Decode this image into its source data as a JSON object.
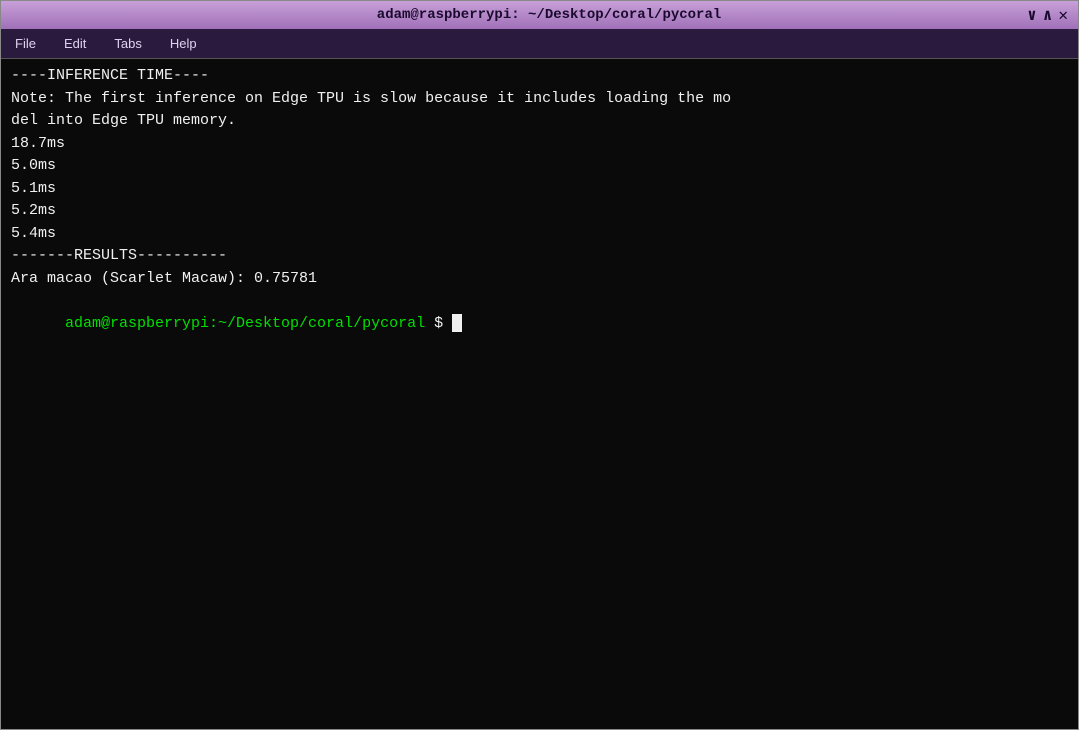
{
  "titlebar": {
    "title": "adam@raspberrypi: ~/Desktop/coral/pycoral",
    "chevron_down": "∨",
    "chevron_up": "∧",
    "close": "✕"
  },
  "menubar": {
    "items": [
      "File",
      "Edit",
      "Tabs",
      "Help"
    ]
  },
  "terminal": {
    "lines": [
      {
        "text": "----INFERENCE TIME----",
        "color": "white"
      },
      {
        "text": "Note: The first inference on Edge TPU is slow because it includes loading the mo",
        "color": "white"
      },
      {
        "text": "del into Edge TPU memory.",
        "color": "white"
      },
      {
        "text": "18.7ms",
        "color": "white"
      },
      {
        "text": "5.0ms",
        "color": "white"
      },
      {
        "text": "5.1ms",
        "color": "white"
      },
      {
        "text": "5.2ms",
        "color": "white"
      },
      {
        "text": "5.4ms",
        "color": "white"
      },
      {
        "text": "-------RESULTS----------",
        "color": "white"
      },
      {
        "text": "Ara macao (Scarlet Macaw): 0.75781",
        "color": "white"
      }
    ],
    "prompt_green": "adam@raspberrypi:~/Desktop/coral/pycoral",
    "prompt_white": " $ "
  }
}
